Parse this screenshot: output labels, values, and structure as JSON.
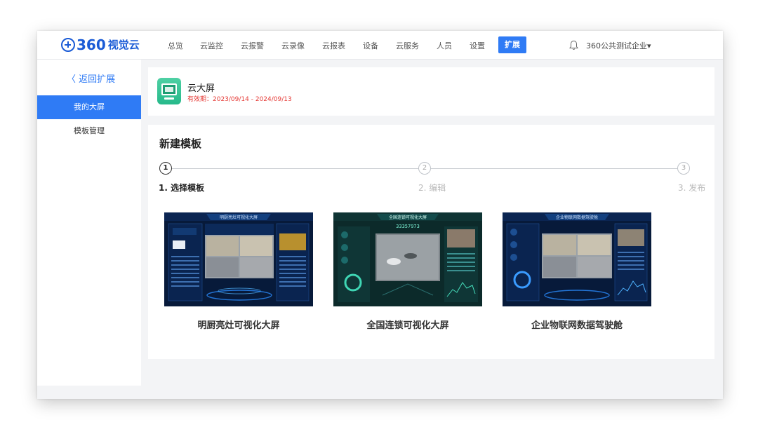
{
  "header": {
    "logo_number": "360",
    "logo_text": "视觉云",
    "nav": [
      {
        "label": "总览"
      },
      {
        "label": "云监控"
      },
      {
        "label": "云报警"
      },
      {
        "label": "云录像"
      },
      {
        "label": "云报表"
      },
      {
        "label": "设备"
      },
      {
        "label": "云服务"
      },
      {
        "label": "人员"
      },
      {
        "label": "设置"
      },
      {
        "label": "扩展",
        "active": true
      }
    ],
    "company": "360公共测试企业▾"
  },
  "sidebar": {
    "back_label": "〈 返回扩展",
    "items": [
      {
        "label": "我的大屏",
        "active": true
      },
      {
        "label": "模板管理"
      }
    ]
  },
  "app": {
    "name": "云大屏",
    "validity": "有效期：2023/09/14 - 2024/09/13",
    "icon": "big-screen-icon"
  },
  "wizard": {
    "title": "新建模板",
    "steps": [
      {
        "num": "1",
        "label": "1. 选择模板",
        "active": true
      },
      {
        "num": "2",
        "label": "2. 编辑"
      },
      {
        "num": "3",
        "label": "3. 发布"
      }
    ]
  },
  "templates": [
    {
      "name": "明厨亮灶可视化大屏",
      "thumb_title": "明厨亮灶可视化大屏"
    },
    {
      "name": "全国连锁可视化大屏",
      "thumb_title": "全国连锁可视化大屏",
      "thumb_counter": "33357973"
    },
    {
      "name": "企业物联网数据驾驶舱",
      "thumb_title": "企业物联网数据驾驶舱"
    }
  ],
  "colors": {
    "primary": "#2f7bf5",
    "logo": "#1a5bd6",
    "validity": "#e53935",
    "dashboard_bg": "#071a3a",
    "dashboard_teal": "#0c2a2a"
  }
}
